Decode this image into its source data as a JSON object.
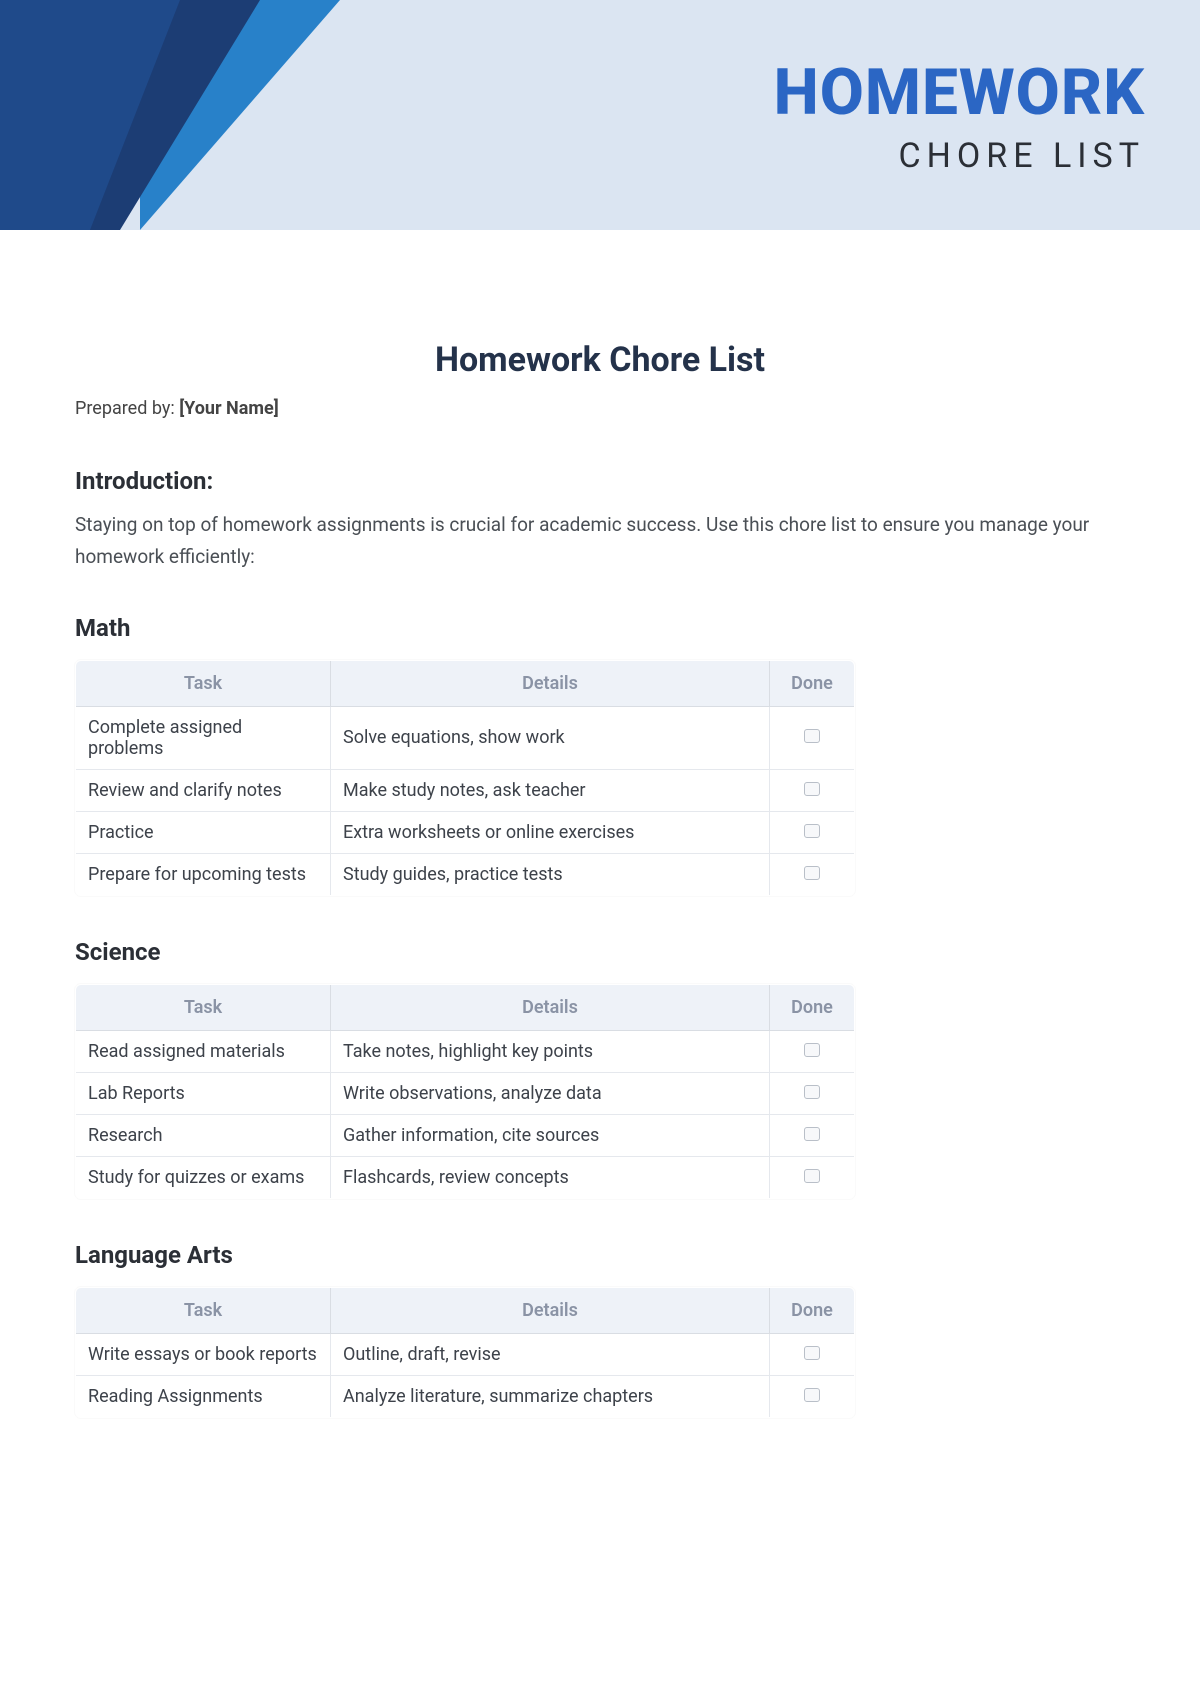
{
  "banner": {
    "title": "HOMEWORK",
    "subtitle": "CHORE LIST"
  },
  "page_title": "Homework Chore List",
  "prepared_label": "Prepared by: ",
  "prepared_value": "[Your Name]",
  "intro_heading": "Introduction:",
  "intro_text": "Staying on top of homework assignments is crucial for academic success. Use this chore list to ensure you manage your homework efficiently:",
  "columns": {
    "task": "Task",
    "details": "Details",
    "done": "Done"
  },
  "subjects": [
    {
      "name": "Math",
      "rows": [
        {
          "task": "Complete assigned problems",
          "details": "Solve equations, show work"
        },
        {
          "task": "Review and clarify notes",
          "details": "Make study notes, ask teacher"
        },
        {
          "task": "Practice",
          "details": "Extra worksheets or online exercises"
        },
        {
          "task": "Prepare for upcoming tests",
          "details": "Study guides, practice tests"
        }
      ]
    },
    {
      "name": "Science",
      "rows": [
        {
          "task": "Read assigned materials",
          "details": "Take notes, highlight key points"
        },
        {
          "task": "Lab Reports",
          "details": "Write observations, analyze data"
        },
        {
          "task": "Research",
          "details": "Gather information, cite sources"
        },
        {
          "task": "Study for quizzes or exams",
          "details": "Flashcards, review concepts"
        }
      ]
    },
    {
      "name": "Language Arts",
      "rows": [
        {
          "task": "Write essays or book reports",
          "details": "Outline, draft, revise"
        },
        {
          "task": "Reading Assignments",
          "details": "Analyze literature, summarize chapters"
        }
      ]
    }
  ]
}
